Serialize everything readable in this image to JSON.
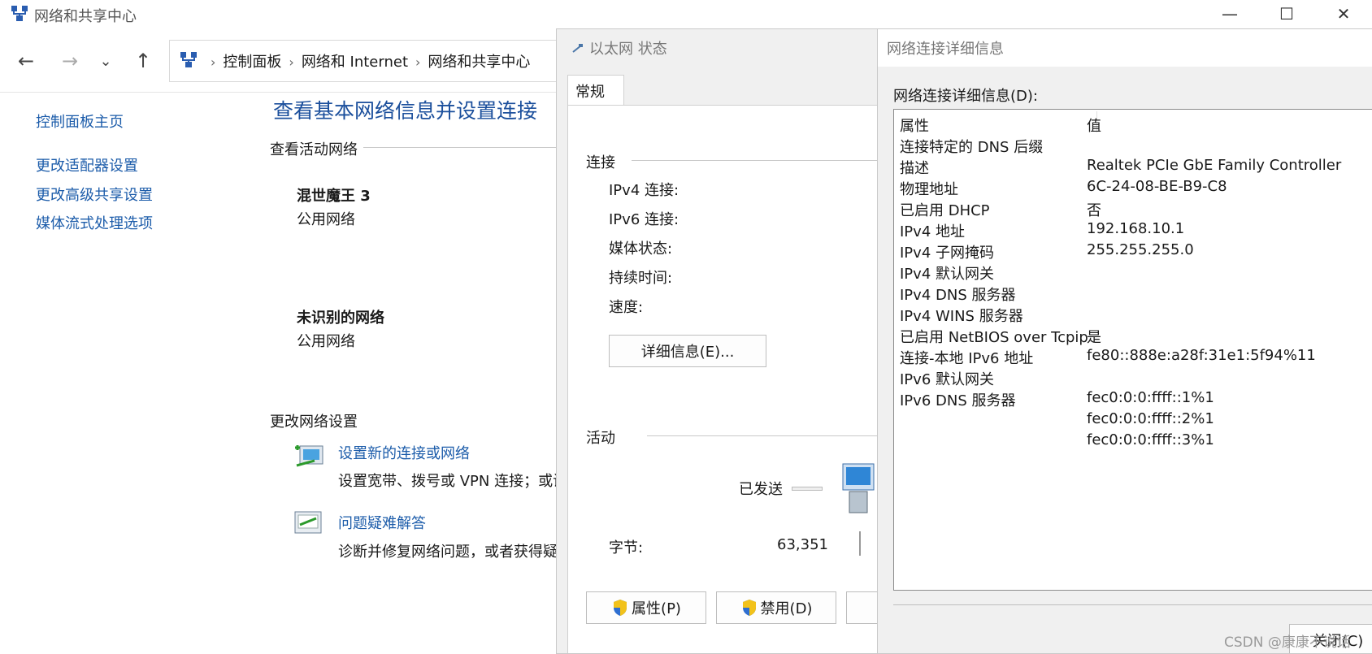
{
  "main_window": {
    "title": "网络和共享中心",
    "controls": {
      "minimize": "—",
      "maximize": "☐",
      "close": "✕"
    },
    "nav": {
      "back": "←",
      "forward": "→",
      "recent": "⌄",
      "up": "↑"
    },
    "breadcrumb": [
      "控制面板",
      "网络和 Internet",
      "网络和共享中心"
    ],
    "sidebar": {
      "home": "控制面板主页",
      "items": [
        "更改适配器设置",
        "更改高级共享设置",
        "媒体流式处理选项"
      ]
    },
    "page_title": "查看基本网络信息并设置连接",
    "active_networks_heading": "查看活动网络",
    "networks": [
      {
        "name": "混世魔王 3",
        "type": "公用网络"
      },
      {
        "name": "未识别的网络",
        "type": "公用网络"
      }
    ],
    "change_settings_heading": "更改网络设置",
    "tasks": [
      {
        "title": "设置新的连接或网络",
        "desc": "设置宽带、拨号或 VPN 连接；或设"
      },
      {
        "title": "问题疑难解答",
        "desc": "诊断并修复网络问题，或者获得疑"
      }
    ]
  },
  "status_dialog": {
    "title": "以太网 状态",
    "tab": "常规",
    "connection_heading": "连接",
    "fields": [
      "IPv4 连接:",
      "IPv6 连接:",
      "媒体状态:",
      "持续时间:",
      "速度:"
    ],
    "details_button": "详细信息(E)...",
    "activity_heading": "活动",
    "sent_label": "已发送",
    "bytes_label": "字节:",
    "bytes_sent": "63,351",
    "properties_button": "属性(P)",
    "disable_button": "禁用(D)"
  },
  "details_dialog": {
    "title": "网络连接详细信息",
    "caption": "网络连接详细信息(D):",
    "columns": [
      "属性",
      "值"
    ],
    "rows": [
      [
        "连接特定的 DNS 后缀",
        ""
      ],
      [
        "描述",
        "Realtek PCIe GbE Family Controller"
      ],
      [
        "物理地址",
        "6C-24-08-BE-B9-C8"
      ],
      [
        "已启用 DHCP",
        "否"
      ],
      [
        "IPv4 地址",
        "192.168.10.1"
      ],
      [
        "IPv4 子网掩码",
        "255.255.255.0"
      ],
      [
        "IPv4 默认网关",
        ""
      ],
      [
        "IPv4 DNS 服务器",
        ""
      ],
      [
        "IPv4 WINS 服务器",
        ""
      ],
      [
        "已启用 NetBIOS over Tcpip",
        "是"
      ],
      [
        "连接-本地 IPv6 地址",
        "fe80::888e:a28f:31e1:5f94%11"
      ],
      [
        "IPv6 默认网关",
        ""
      ],
      [
        "IPv6 DNS 服务器",
        "fec0:0:0:ffff::1%1"
      ],
      [
        "",
        "fec0:0:0:ffff::2%1"
      ],
      [
        "",
        "fec0:0:0:ffff::3%1"
      ]
    ],
    "close_button": "关闭(C)"
  },
  "watermark": "CSDN @康康不说话"
}
